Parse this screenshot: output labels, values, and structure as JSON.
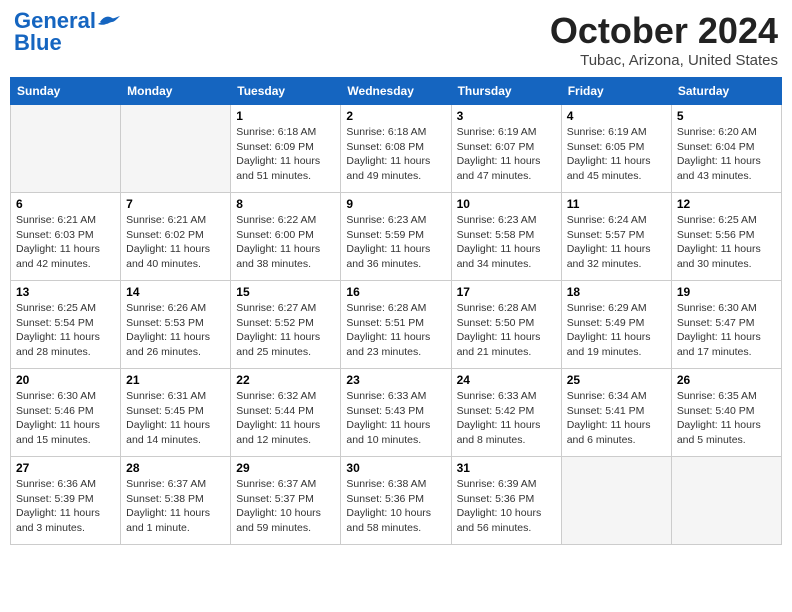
{
  "header": {
    "logo_general": "General",
    "logo_blue": "Blue",
    "month_title": "October 2024",
    "location": "Tubac, Arizona, United States"
  },
  "days_of_week": [
    "Sunday",
    "Monday",
    "Tuesday",
    "Wednesday",
    "Thursday",
    "Friday",
    "Saturday"
  ],
  "weeks": [
    [
      {
        "day": "",
        "sunrise": "",
        "sunset": "",
        "daylight": "",
        "empty": true
      },
      {
        "day": "",
        "sunrise": "",
        "sunset": "",
        "daylight": "",
        "empty": true
      },
      {
        "day": "1",
        "sunrise": "Sunrise: 6:18 AM",
        "sunset": "Sunset: 6:09 PM",
        "daylight": "Daylight: 11 hours and 51 minutes."
      },
      {
        "day": "2",
        "sunrise": "Sunrise: 6:18 AM",
        "sunset": "Sunset: 6:08 PM",
        "daylight": "Daylight: 11 hours and 49 minutes."
      },
      {
        "day": "3",
        "sunrise": "Sunrise: 6:19 AM",
        "sunset": "Sunset: 6:07 PM",
        "daylight": "Daylight: 11 hours and 47 minutes."
      },
      {
        "day": "4",
        "sunrise": "Sunrise: 6:19 AM",
        "sunset": "Sunset: 6:05 PM",
        "daylight": "Daylight: 11 hours and 45 minutes."
      },
      {
        "day": "5",
        "sunrise": "Sunrise: 6:20 AM",
        "sunset": "Sunset: 6:04 PM",
        "daylight": "Daylight: 11 hours and 43 minutes."
      }
    ],
    [
      {
        "day": "6",
        "sunrise": "Sunrise: 6:21 AM",
        "sunset": "Sunset: 6:03 PM",
        "daylight": "Daylight: 11 hours and 42 minutes."
      },
      {
        "day": "7",
        "sunrise": "Sunrise: 6:21 AM",
        "sunset": "Sunset: 6:02 PM",
        "daylight": "Daylight: 11 hours and 40 minutes."
      },
      {
        "day": "8",
        "sunrise": "Sunrise: 6:22 AM",
        "sunset": "Sunset: 6:00 PM",
        "daylight": "Daylight: 11 hours and 38 minutes."
      },
      {
        "day": "9",
        "sunrise": "Sunrise: 6:23 AM",
        "sunset": "Sunset: 5:59 PM",
        "daylight": "Daylight: 11 hours and 36 minutes."
      },
      {
        "day": "10",
        "sunrise": "Sunrise: 6:23 AM",
        "sunset": "Sunset: 5:58 PM",
        "daylight": "Daylight: 11 hours and 34 minutes."
      },
      {
        "day": "11",
        "sunrise": "Sunrise: 6:24 AM",
        "sunset": "Sunset: 5:57 PM",
        "daylight": "Daylight: 11 hours and 32 minutes."
      },
      {
        "day": "12",
        "sunrise": "Sunrise: 6:25 AM",
        "sunset": "Sunset: 5:56 PM",
        "daylight": "Daylight: 11 hours and 30 minutes."
      }
    ],
    [
      {
        "day": "13",
        "sunrise": "Sunrise: 6:25 AM",
        "sunset": "Sunset: 5:54 PM",
        "daylight": "Daylight: 11 hours and 28 minutes."
      },
      {
        "day": "14",
        "sunrise": "Sunrise: 6:26 AM",
        "sunset": "Sunset: 5:53 PM",
        "daylight": "Daylight: 11 hours and 26 minutes."
      },
      {
        "day": "15",
        "sunrise": "Sunrise: 6:27 AM",
        "sunset": "Sunset: 5:52 PM",
        "daylight": "Daylight: 11 hours and 25 minutes."
      },
      {
        "day": "16",
        "sunrise": "Sunrise: 6:28 AM",
        "sunset": "Sunset: 5:51 PM",
        "daylight": "Daylight: 11 hours and 23 minutes."
      },
      {
        "day": "17",
        "sunrise": "Sunrise: 6:28 AM",
        "sunset": "Sunset: 5:50 PM",
        "daylight": "Daylight: 11 hours and 21 minutes."
      },
      {
        "day": "18",
        "sunrise": "Sunrise: 6:29 AM",
        "sunset": "Sunset: 5:49 PM",
        "daylight": "Daylight: 11 hours and 19 minutes."
      },
      {
        "day": "19",
        "sunrise": "Sunrise: 6:30 AM",
        "sunset": "Sunset: 5:47 PM",
        "daylight": "Daylight: 11 hours and 17 minutes."
      }
    ],
    [
      {
        "day": "20",
        "sunrise": "Sunrise: 6:30 AM",
        "sunset": "Sunset: 5:46 PM",
        "daylight": "Daylight: 11 hours and 15 minutes."
      },
      {
        "day": "21",
        "sunrise": "Sunrise: 6:31 AM",
        "sunset": "Sunset: 5:45 PM",
        "daylight": "Daylight: 11 hours and 14 minutes."
      },
      {
        "day": "22",
        "sunrise": "Sunrise: 6:32 AM",
        "sunset": "Sunset: 5:44 PM",
        "daylight": "Daylight: 11 hours and 12 minutes."
      },
      {
        "day": "23",
        "sunrise": "Sunrise: 6:33 AM",
        "sunset": "Sunset: 5:43 PM",
        "daylight": "Daylight: 11 hours and 10 minutes."
      },
      {
        "day": "24",
        "sunrise": "Sunrise: 6:33 AM",
        "sunset": "Sunset: 5:42 PM",
        "daylight": "Daylight: 11 hours and 8 minutes."
      },
      {
        "day": "25",
        "sunrise": "Sunrise: 6:34 AM",
        "sunset": "Sunset: 5:41 PM",
        "daylight": "Daylight: 11 hours and 6 minutes."
      },
      {
        "day": "26",
        "sunrise": "Sunrise: 6:35 AM",
        "sunset": "Sunset: 5:40 PM",
        "daylight": "Daylight: 11 hours and 5 minutes."
      }
    ],
    [
      {
        "day": "27",
        "sunrise": "Sunrise: 6:36 AM",
        "sunset": "Sunset: 5:39 PM",
        "daylight": "Daylight: 11 hours and 3 minutes."
      },
      {
        "day": "28",
        "sunrise": "Sunrise: 6:37 AM",
        "sunset": "Sunset: 5:38 PM",
        "daylight": "Daylight: 11 hours and 1 minute."
      },
      {
        "day": "29",
        "sunrise": "Sunrise: 6:37 AM",
        "sunset": "Sunset: 5:37 PM",
        "daylight": "Daylight: 10 hours and 59 minutes."
      },
      {
        "day": "30",
        "sunrise": "Sunrise: 6:38 AM",
        "sunset": "Sunset: 5:36 PM",
        "daylight": "Daylight: 10 hours and 58 minutes."
      },
      {
        "day": "31",
        "sunrise": "Sunrise: 6:39 AM",
        "sunset": "Sunset: 5:36 PM",
        "daylight": "Daylight: 10 hours and 56 minutes."
      },
      {
        "day": "",
        "sunrise": "",
        "sunset": "",
        "daylight": "",
        "empty": true
      },
      {
        "day": "",
        "sunrise": "",
        "sunset": "",
        "daylight": "",
        "empty": true
      }
    ]
  ]
}
